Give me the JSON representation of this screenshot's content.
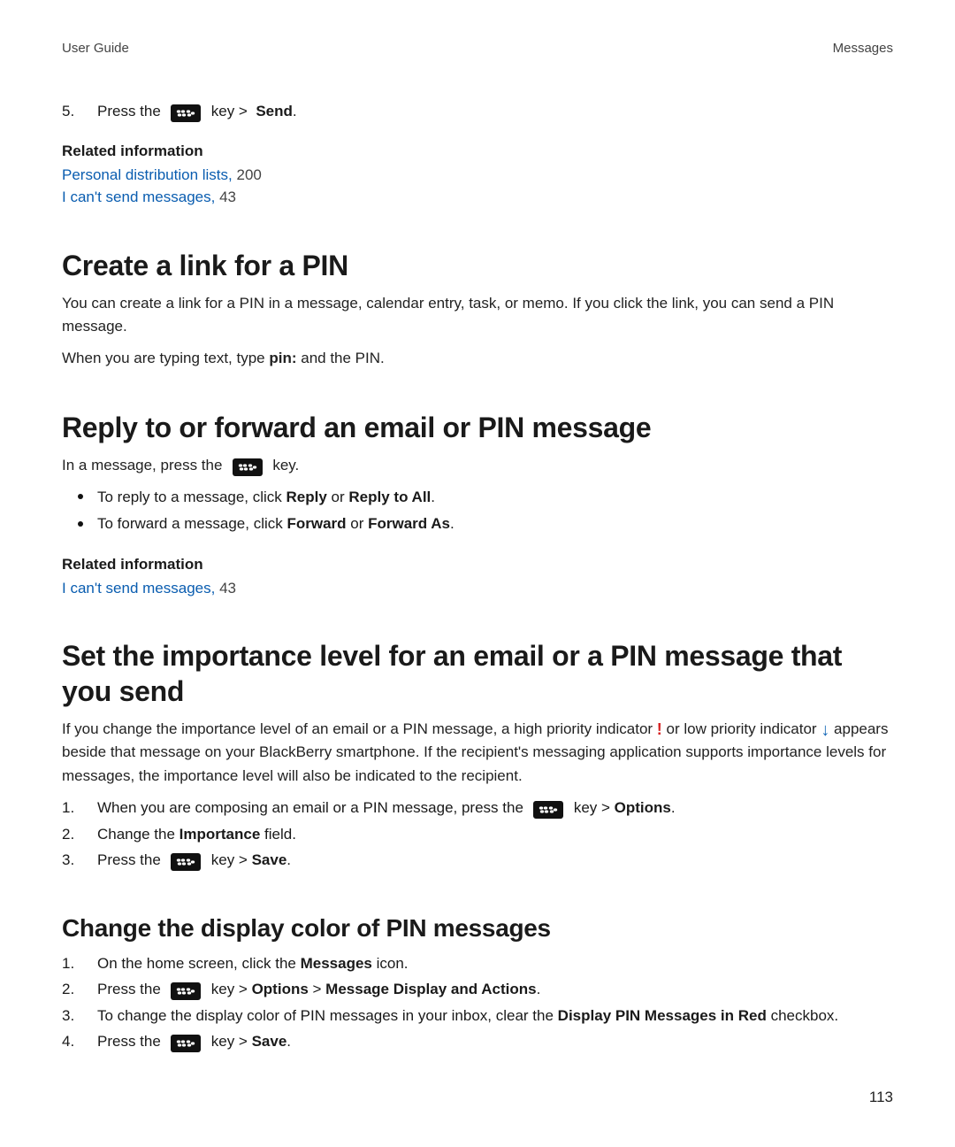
{
  "header": {
    "doc_title": "User Guide",
    "section": "Messages"
  },
  "step5": {
    "num": "5.",
    "pre": "Press the ",
    "post_key": " key > ",
    "action": "Send",
    "end": "."
  },
  "related1": {
    "heading": "Related information",
    "links": [
      {
        "text": "Personal distribution lists,",
        "page": " 200"
      },
      {
        "text": "I can't send messages,",
        "page": " 43"
      }
    ]
  },
  "sec_create": {
    "heading": "Create a link for a PIN",
    "p1": "You can create a link for a PIN in a message, calendar entry, task, or memo. If you click the link, you can send a PIN message.",
    "p2_pre": "When you are typing text, type ",
    "p2_bold": "pin:",
    "p2_post": " and the PIN."
  },
  "sec_reply": {
    "heading": "Reply to or forward an email or PIN message",
    "intro_pre": "In a message, press the ",
    "intro_post": " key.",
    "bullets": [
      {
        "pre": "To reply to a message, click ",
        "b1": "Reply",
        "mid": " or ",
        "b2": "Reply to All",
        "end": "."
      },
      {
        "pre": "To forward a message, click ",
        "b1": "Forward",
        "mid": " or ",
        "b2": "Forward As",
        "end": "."
      }
    ],
    "related": {
      "heading": "Related information",
      "links": [
        {
          "text": "I can't send messages,",
          "page": " 43"
        }
      ]
    }
  },
  "sec_importance": {
    "heading": "Set the importance level for an email or a PIN message that you send",
    "p_pre": "If you change the importance level of an email or a PIN message, a high priority indicator ",
    "hi": "!",
    "p_mid": " or low priority indicator ",
    "lo": "↓",
    "p_post": " appears beside that message on your BlackBerry smartphone. If the recipient's messaging application supports importance levels for messages, the importance level will also be indicated to the recipient.",
    "steps": [
      {
        "num": "1.",
        "pre": "When you are composing an email or a PIN message, press the ",
        "post_key": " key > ",
        "b1": "Options",
        "end": "."
      },
      {
        "num": "2.",
        "pre": "Change the ",
        "b1": "Importance",
        "post": " field."
      },
      {
        "num": "3.",
        "pre": "Press the ",
        "post_key": " key > ",
        "b1": "Save",
        "end": "."
      }
    ]
  },
  "sec_color": {
    "heading": "Change the display color of PIN messages",
    "steps": [
      {
        "num": "1.",
        "pre": "On the home screen, click the ",
        "b1": "Messages",
        "post": " icon."
      },
      {
        "num": "2.",
        "pre": "Press the ",
        "post_key": " key > ",
        "b1": "Options",
        "mid": " > ",
        "b2": "Message Display and Actions",
        "end": "."
      },
      {
        "num": "3.",
        "pre": "To change the display color of PIN messages in your inbox, clear the ",
        "b1": "Display PIN Messages in Red",
        "post": " checkbox."
      },
      {
        "num": "4.",
        "pre": "Press the ",
        "post_key": " key > ",
        "b1": "Save",
        "end": "."
      }
    ]
  },
  "page_number": "113"
}
